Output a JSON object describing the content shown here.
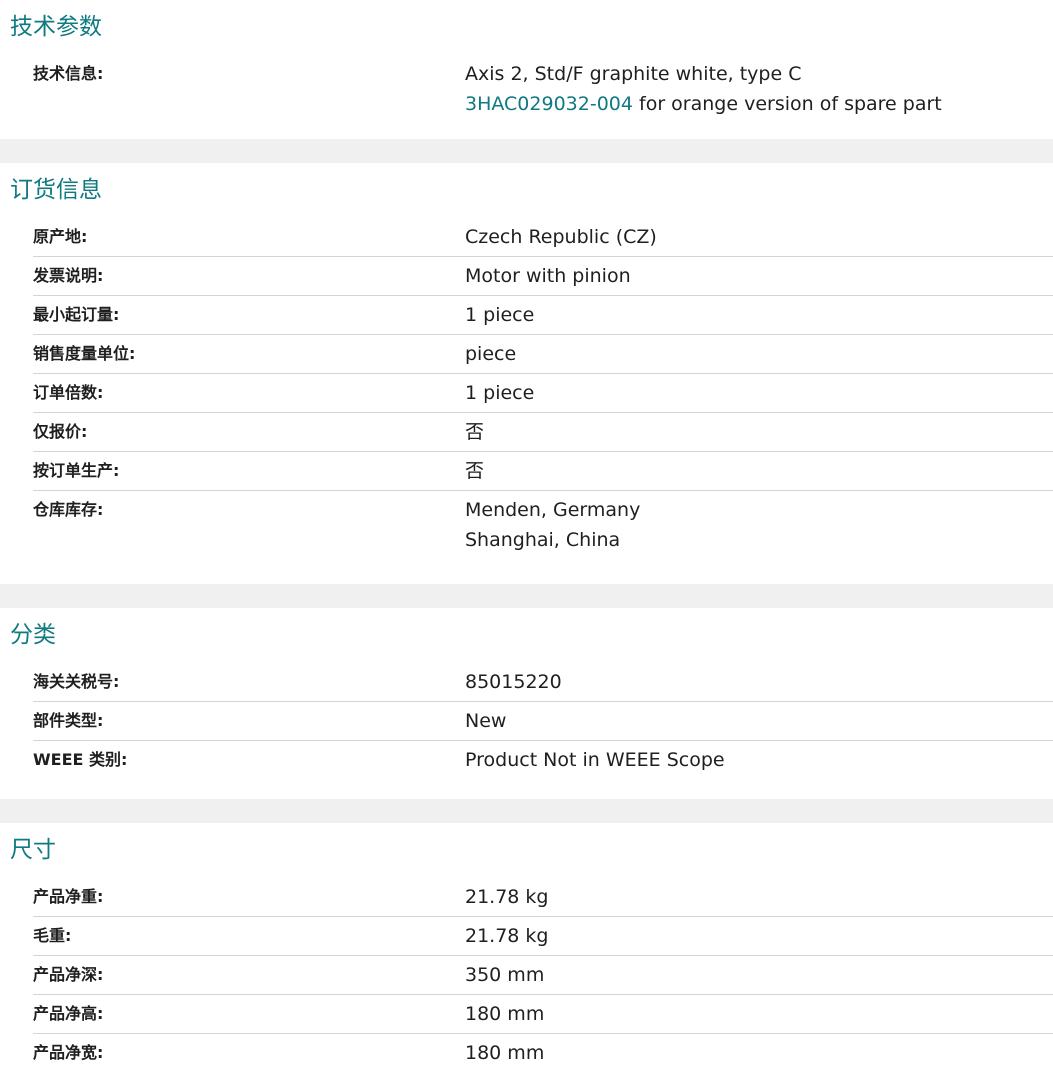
{
  "sections": {
    "tech": {
      "title": "技术参数",
      "rows": [
        {
          "label": "技术信息:",
          "line1": "Axis 2, Std/F graphite white, type C",
          "link": "3HAC029032-004",
          "line2_suffix": " for orange version of spare part"
        }
      ]
    },
    "order": {
      "title": "订货信息",
      "rows": [
        {
          "label": "原产地:",
          "value": "Czech Republic (CZ)"
        },
        {
          "label": "发票说明:",
          "value": "Motor with pinion"
        },
        {
          "label": "最小起订量:",
          "value": "1 piece"
        },
        {
          "label": "销售度量单位:",
          "value": "piece"
        },
        {
          "label": "订单倍数:",
          "value": "1 piece"
        },
        {
          "label": "仅报价:",
          "value": "否"
        },
        {
          "label": "按订单生产:",
          "value": "否"
        },
        {
          "label": "仓库库存:",
          "value": [
            "Menden, Germany",
            "Shanghai, China"
          ]
        }
      ]
    },
    "classification": {
      "title": "分类",
      "rows": [
        {
          "label": "海关关税号:",
          "value": "85015220"
        },
        {
          "label": "部件类型:",
          "value": "New"
        },
        {
          "label": "WEEE 类别:",
          "value": "Product Not in WEEE Scope"
        }
      ]
    },
    "dimensions": {
      "title": "尺寸",
      "rows": [
        {
          "label": "产品净重:",
          "value": "21.78 kg"
        },
        {
          "label": "毛重:",
          "value": "21.78 kg"
        },
        {
          "label": "产品净深:",
          "value": "350 mm"
        },
        {
          "label": "产品净高:",
          "value": "180 mm"
        },
        {
          "label": "产品净宽:",
          "value": "180 mm"
        }
      ]
    }
  },
  "colors": {
    "accent": "#0f7a82",
    "separator": "#f0f0f0",
    "row_border": "#d4d4d4"
  }
}
